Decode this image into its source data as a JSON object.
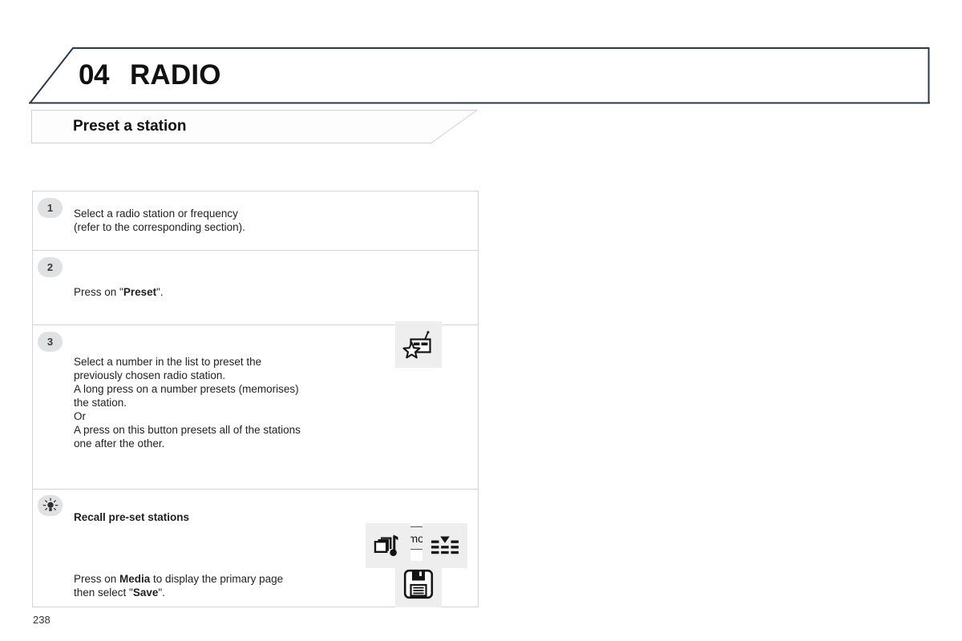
{
  "chapter": {
    "number": "04",
    "name": "RADIO",
    "accent_color": "#2b3a4a"
  },
  "section": {
    "title": "Preset a station"
  },
  "steps": [
    {
      "badge": "1",
      "icon_name": "step-badge-1",
      "lines": [
        "Select a radio station or frequency",
        "(refer to the corresponding section)."
      ]
    },
    {
      "badge": "2",
      "icon_name": "step-badge-2",
      "text_prefix": "Press on \"",
      "text_bold": "Preset",
      "text_suffix": "\".",
      "icon": "radio-preset-icon"
    },
    {
      "badge": "3",
      "icon_name": "step-badge-3",
      "paragraphs": [
        "Select a number in the list to preset the\npreviously chosen radio station.",
        "A long press on a number presets (memorises)\nthe station.",
        "Or",
        "A press on this button presets all of the stations\none after the other."
      ],
      "button_label": "Mémoire 1",
      "button_icon": "memory-bar-icon",
      "icon": "floppy-save-icon"
    }
  ],
  "tip": {
    "badge_icon": "lightbulb-icon",
    "heading": "Recall pre-set stations",
    "body_prefix": "Press on ",
    "body_bold1": "Media",
    "body_mid": " to display the primary page\nthen select \"",
    "body_bold2": "Save",
    "body_suffix": "\".",
    "icons": [
      "media-note-icon",
      "list-menu-icon"
    ]
  },
  "footer": {
    "page_number": "238"
  }
}
